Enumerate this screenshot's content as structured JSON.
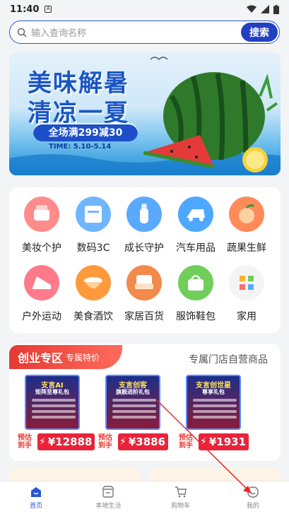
{
  "status_bar": {
    "time": "11:40",
    "notif_glyph": "A"
  },
  "search": {
    "placeholder": "输入查询名称",
    "button_label": "搜索"
  },
  "banner": {
    "title_line1": "美味解暑",
    "title_line2": "清凉一夏",
    "promo": "全场满299减30",
    "dates": "TIME: 5.10-5.14"
  },
  "categories": [
    {
      "label": "美妆个护",
      "icon": "cosmetics-icon",
      "color": "#ff8c8c"
    },
    {
      "label": "数码3C",
      "icon": "printer-icon",
      "color": "#6fb6ff"
    },
    {
      "label": "成长守护",
      "icon": "baby-bottle-icon",
      "color": "#5aa9ff"
    },
    {
      "label": "汽车用品",
      "icon": "car-wash-icon",
      "color": "#4fa8ff"
    },
    {
      "label": "蔬果生鲜",
      "icon": "peach-icon",
      "color": "#ff8a5a"
    },
    {
      "label": "户外运动",
      "icon": "sneaker-icon",
      "color": "#ff7b8a"
    },
    {
      "label": "美食酒饮",
      "icon": "pot-icon",
      "color": "#ff9a3c"
    },
    {
      "label": "家居百货",
      "icon": "armchair-icon",
      "color": "#f28a4b"
    },
    {
      "label": "服饰鞋包",
      "icon": "handbag-icon",
      "color": "#6fcf5a"
    },
    {
      "label": "家用",
      "icon": "grid-icon",
      "color": "#f0a0a0"
    }
  ],
  "zone": {
    "tab_title": "创业专区",
    "tab_subtitle": "专属特价",
    "right_label": "专属门店自营商品",
    "estimate_label_1": "预估",
    "estimate_label_2": "到手",
    "products": [
      {
        "thumb_title": "支言AI",
        "thumb_sub": "矩阵至尊礼包",
        "price": "¥12888"
      },
      {
        "thumb_title": "支言创客",
        "thumb_sub": "旗舰进阶礼包",
        "price": "¥3886"
      },
      {
        "thumb_title": "支言创世星",
        "thumb_sub": "尊享礼包",
        "price": "¥1931"
      }
    ]
  },
  "bottom_nav": [
    {
      "label": "首页",
      "icon": "home-icon",
      "active": true
    },
    {
      "label": "本地生活",
      "icon": "shop-icon",
      "active": false
    },
    {
      "label": "购物车",
      "icon": "cart-icon",
      "active": false
    },
    {
      "label": "我的",
      "icon": "profile-icon",
      "active": false
    }
  ],
  "colors": {
    "accent": "#2b56d6",
    "price_red": "#e8233a",
    "zone_red": "#e53935"
  }
}
